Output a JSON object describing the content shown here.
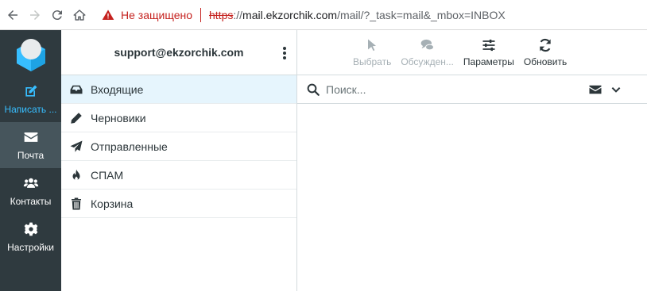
{
  "browser": {
    "back_icon": "arrow-left-icon",
    "forward_icon": "arrow-right-icon",
    "reload_icon": "reload-icon",
    "home_icon": "home-icon",
    "security_warning": "Не защищено",
    "url_scheme": "https",
    "url_scheme_sep": "://",
    "url_host": "mail.ekzorchik.com",
    "url_path": "/mail/?_task=mail&_mbox=INBOX"
  },
  "appnav": {
    "items": [
      {
        "label": "Написать ...",
        "icon": "compose-icon"
      },
      {
        "label": "Почта",
        "icon": "envelope-icon"
      },
      {
        "label": "Контакты",
        "icon": "users-icon"
      },
      {
        "label": "Настройки",
        "icon": "gear-icon"
      }
    ]
  },
  "folders": {
    "account": "support@ekzorchik.com",
    "items": [
      {
        "label": "Входящие",
        "icon": "inbox-icon"
      },
      {
        "label": "Черновики",
        "icon": "pencil-icon"
      },
      {
        "label": "Отправленные",
        "icon": "paper-plane-icon"
      },
      {
        "label": "СПАМ",
        "icon": "fire-icon"
      },
      {
        "label": "Корзина",
        "icon": "trash-icon"
      }
    ]
  },
  "toolbar": {
    "select": "Выбрать",
    "threads": "Обсужден...",
    "options": "Параметры",
    "refresh": "Обновить"
  },
  "search": {
    "placeholder": "Поиск...",
    "value": ""
  },
  "colors": {
    "nav_bg": "#2f3a3f",
    "nav_active": "#46555c",
    "accent": "#37beff",
    "selected_folder": "#e6f5fd",
    "warning": "#c5221f"
  }
}
